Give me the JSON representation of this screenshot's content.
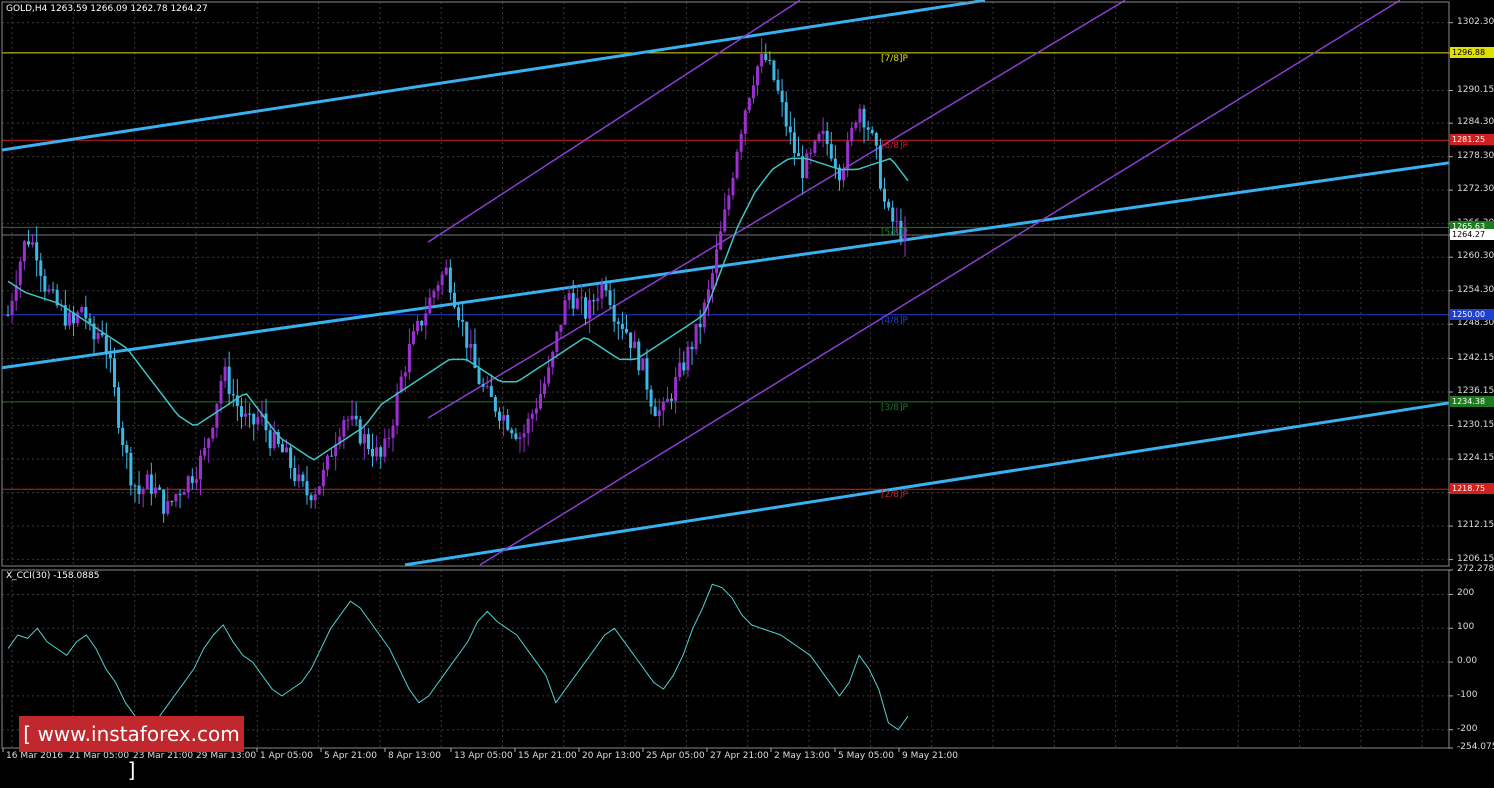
{
  "header": {
    "symbol_text": "GOLD,H4  1263.59 1266.09 1262.78 1264.27",
    "indicator_text": "X_CCI(30) -158.0885"
  },
  "watermark": {
    "text": "[  www.instaforex.com  ]"
  },
  "colors": {
    "background": "#000000",
    "grid": "#3a3a3a",
    "bull_candle": "#9b30d0",
    "bear_candle": "#3fb7e6",
    "ma_line": "#3fc4c4",
    "channel_wide": "#39b0ef",
    "channel_narrow": "#8a3fd0",
    "level_yellow": "#e0e000",
    "level_red": "#d02020",
    "level_green": "#1f7a1f",
    "level_blue": "#1f3fd0",
    "cci_line": "#4fd0d0"
  },
  "chart_data": [
    {
      "type": "candlestick",
      "title": "GOLD,H4",
      "ohlc_last": {
        "open": 1263.59,
        "high": 1266.09,
        "low": 1262.78,
        "close": 1264.27
      },
      "y_ticks": [
        1302.3,
        1296.88,
        1290.15,
        1284.3,
        1278.3,
        1272.3,
        1266.3,
        1264.27,
        1260.3,
        1254.3,
        1248.3,
        1242.15,
        1236.15,
        1230.15,
        1224.15,
        1218.15,
        1212.15,
        1206.15
      ],
      "ylim": [
        1205.0,
        1306.0
      ],
      "x_ticks": [
        "16 Mar 2016",
        "21 Mar 05:00",
        "23 Mar 21:00",
        "29 Mar 13:00",
        "1 Apr 05:00",
        "5 Apr 21:00",
        "8 Apr 13:00",
        "13 Apr 05:00",
        "15 Apr 21:00",
        "20 Apr 13:00",
        "25 Apr 05:00",
        "27 Apr 21:00",
        "2 May 13:00",
        "5 May 05:00",
        "9 May 21:00"
      ],
      "close_path": [
        1250,
        1258,
        1264,
        1262,
        1255,
        1252,
        1250,
        1248,
        1252,
        1245,
        1248,
        1240,
        1230,
        1222,
        1218,
        1220,
        1218,
        1215,
        1218,
        1220,
        1222,
        1225,
        1232,
        1240,
        1236,
        1232,
        1230,
        1232,
        1228,
        1226,
        1224,
        1220,
        1218,
        1219,
        1222,
        1228,
        1232,
        1230,
        1228,
        1226,
        1224,
        1230,
        1238,
        1244,
        1248,
        1252,
        1256,
        1258,
        1252,
        1246,
        1240,
        1236,
        1234,
        1232,
        1230,
        1228,
        1232,
        1236,
        1240,
        1248,
        1254,
        1252,
        1250,
        1254,
        1256,
        1250,
        1248,
        1244,
        1240,
        1234,
        1232,
        1236,
        1240,
        1244,
        1248,
        1254,
        1262,
        1270,
        1280,
        1288,
        1294,
        1296,
        1292,
        1286,
        1280,
        1276,
        1278,
        1282,
        1280,
        1276,
        1280,
        1288,
        1284,
        1278,
        1268,
        1266,
        1264
      ],
      "ma_path": [
        1256,
        1254,
        1253,
        1252,
        1250,
        1248,
        1246,
        1244,
        1240,
        1236,
        1232,
        1230,
        1232,
        1234,
        1236,
        1232,
        1228,
        1226,
        1224,
        1226,
        1228,
        1230,
        1234,
        1236,
        1238,
        1240,
        1242,
        1242,
        1240,
        1238,
        1238,
        1240,
        1242,
        1244,
        1246,
        1244,
        1242,
        1242,
        1244,
        1246,
        1248,
        1250,
        1258,
        1266,
        1272,
        1276,
        1278,
        1278,
        1277,
        1276,
        1276,
        1277,
        1278,
        1274
      ],
      "price_levels": [
        {
          "label": "[7/8]P",
          "value": 1296.88,
          "color": "#e0e000",
          "tag_text": "1296.88"
        },
        {
          "label": "[6/8]P",
          "value": 1281.25,
          "color": "#d02020",
          "tag_text": "1281.25"
        },
        {
          "label": "[5/8]P",
          "value": 1265.63,
          "color": "#1f7a1f",
          "tag_text": "1265.63"
        },
        {
          "label": "[4/8]P",
          "value": 1250.0,
          "color": "#1f3fd0",
          "tag_text": "1250.00"
        },
        {
          "label": "[3/8]P",
          "value": 1234.38,
          "color": "#1f7a1f",
          "tag_text": "1234.38"
        },
        {
          "label": "[2/8]P",
          "value": 1218.75,
          "color": "#d02020",
          "tag_text": "1218.75"
        }
      ],
      "current_price_tag": "1264.27"
    },
    {
      "type": "line",
      "title": "X_CCI(30) -158.0885",
      "y_ticks": [
        "272.278",
        "200",
        "100",
        "0.00",
        "-100",
        "-200",
        "-254.0753"
      ],
      "ylim": [
        -254.0753,
        272.278
      ],
      "values": [
        40,
        80,
        70,
        100,
        60,
        40,
        20,
        60,
        80,
        40,
        -20,
        -60,
        -120,
        -160,
        -200,
        -180,
        -140,
        -100,
        -60,
        -20,
        40,
        80,
        110,
        60,
        20,
        0,
        -40,
        -80,
        -100,
        -80,
        -60,
        -20,
        40,
        100,
        140,
        180,
        160,
        120,
        80,
        40,
        -20,
        -80,
        -120,
        -100,
        -60,
        -20,
        20,
        60,
        120,
        150,
        120,
        100,
        80,
        40,
        0,
        -40,
        -120,
        -80,
        -40,
        0,
        40,
        80,
        100,
        60,
        20,
        -20,
        -60,
        -80,
        -40,
        20,
        100,
        160,
        230,
        220,
        190,
        140,
        110,
        100,
        90,
        80,
        60,
        40,
        20,
        -20,
        -60,
        -100,
        -60,
        20,
        -20,
        -80,
        -180,
        -200,
        -160
      ]
    }
  ]
}
